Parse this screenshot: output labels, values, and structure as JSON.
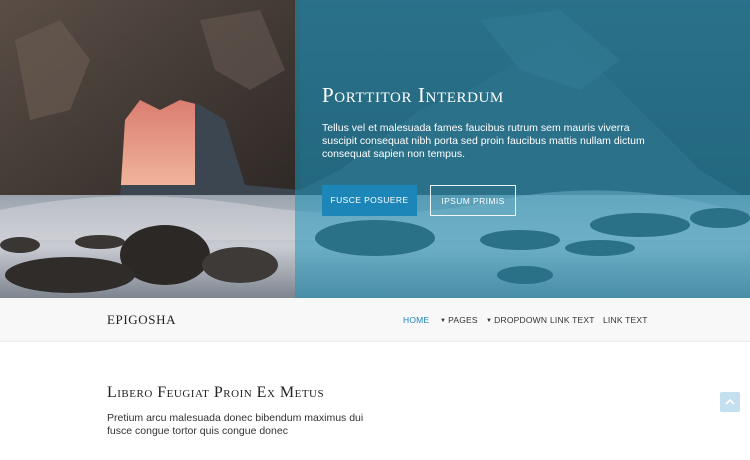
{
  "hero": {
    "title": "Porttitor Interdum",
    "text": "Tellus vel et malesuada fames faucibus rutrum sem mauris viverra suscipit consequat nibh porta sed proin faucibus mattis nullam dictum consequat sapien non tempus.",
    "primary_button": "Fusce Posuere",
    "secondary_button": "Ipsum Primis",
    "overlay_color": "#1e96b9"
  },
  "nav": {
    "brand": "EPIGOSHA",
    "items": [
      {
        "label": "HOME",
        "active": true
      },
      {
        "label": "PAGES",
        "dropdown": true
      },
      {
        "label": "DROPDOWN",
        "dropdown": true
      },
      {
        "label": "LINK TEXT"
      },
      {
        "label": "LINK TEXT"
      }
    ],
    "accent_color": "#1d86b8"
  },
  "main": {
    "title": "Libero Feugiat Proin Ex Metus",
    "text": "Pretium arcu malesuada donec bibendum maximus dui fusce congue tortor quis congue donec"
  },
  "scroll_top": {
    "icon": "chevron-up-icon"
  }
}
